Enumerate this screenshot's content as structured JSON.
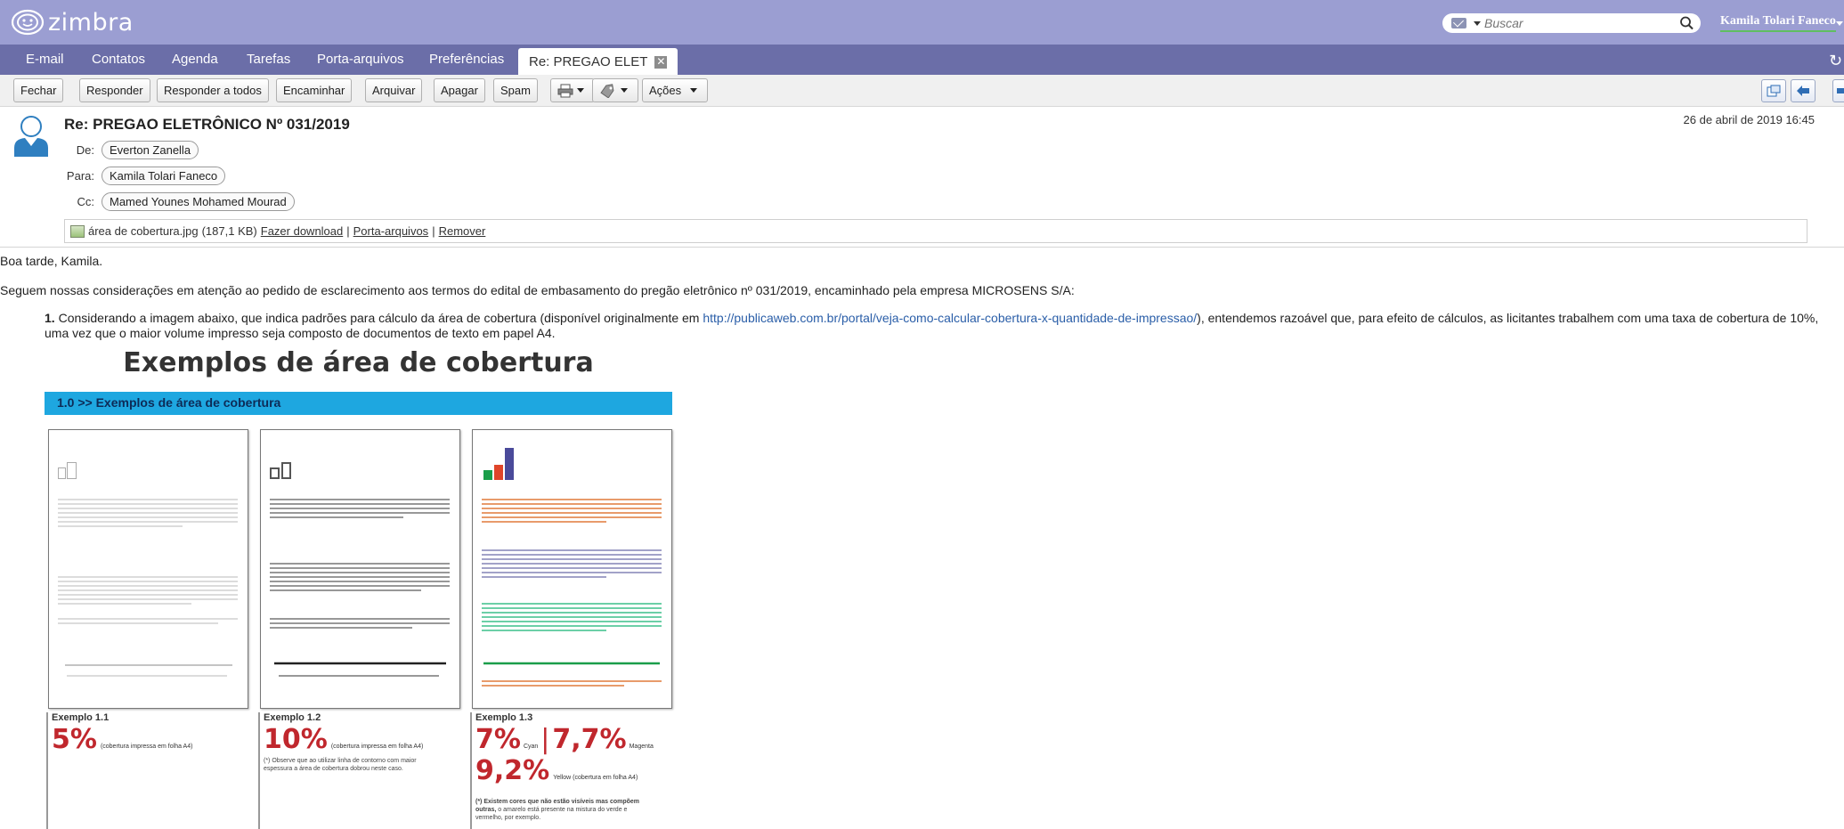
{
  "app": {
    "logo_text": "zimbra",
    "search_placeholder": "Buscar",
    "user_name": "Kamila Tolari Faneco"
  },
  "nav": {
    "tabs": [
      "E-mail",
      "Contatos",
      "Agenda",
      "Tarefas",
      "Porta-arquivos",
      "Preferências"
    ],
    "active_tab": "Re: PREGAO ELET"
  },
  "toolbar": {
    "close": "Fechar",
    "reply": "Responder",
    "reply_all": "Responder a todos",
    "forward": "Encaminhar",
    "archive": "Arquivar",
    "delete": "Apagar",
    "spam": "Spam",
    "actions": "Ações"
  },
  "message": {
    "subject": "Re: PREGAO ELETRÔNICO Nº 031/2019",
    "date": "26 de abril de 2019 16:45",
    "from_label": "De:",
    "from": "Everton Zanella",
    "to_label": "Para:",
    "to": "Kamila Tolari Faneco",
    "cc_label": "Cc:",
    "cc": "Mamed Younes Mohamed Mourad",
    "attachment": {
      "name": "área de cobertura.jpg",
      "size": "(187,1 KB)",
      "download": "Fazer download",
      "briefcase": "Porta-arquivos",
      "remove": "Remover",
      "sep": "|"
    }
  },
  "body": {
    "greeting": "Boa tarde, Kamila.",
    "intro": "Seguem nossas considerações em atenção ao pedido de esclarecimento aos termos do edital de embasamento do pregão eletrônico nº 031/2019, encaminhado pela empresa MICROSENS S/A:",
    "item_number": "1.",
    "item_text_1": " Considerando a imagem abaixo, que indica padrões para cálculo da área de cobertura (disponível originalmente em ",
    "item_link": "http://publicaweb.com.br/portal/veja-como-calcular-cobertura-x-quantidade-de-impressao/",
    "item_text_2": "), entendemos razoável que, para efeito de cálculos, as licitantes trabalhem com uma taxa de cobertura de 10%, uma vez que o maior volume impresso seja composto de documentos de texto em papel A4."
  },
  "image": {
    "title": "Exemplos de área de cobertura",
    "banner": "1.0 >> Exemplos de área de cobertura",
    "ex1": {
      "title": "Exemplo 1.1",
      "value": "5%",
      "caption": "(cobertura impressa em folha A4)"
    },
    "ex2": {
      "title": "Exemplo 1.2",
      "value": "10%",
      "caption": "(cobertura impressa em folha A4)",
      "note": "(*) Observe que ao utilizar linha de contorno com maior espessura a área de cobertura dobrou neste caso."
    },
    "ex3": {
      "title": "Exemplo 1.3",
      "v1": "7%",
      "l1": "Cyan",
      "v2": "7,7%",
      "l2": "Magenta",
      "v3": "9,2%",
      "l3": "Yellow (cobertura em folha A4)",
      "note_bold": "(*) Existem cores que não estão visíveis mas compõem outras,",
      "note": " o amarelo está presente na mistura do verde e vermelho, por exemplo."
    }
  },
  "colors": {
    "topbar": "#9b9ed2",
    "navbar": "#6b6ea8",
    "link": "#2a5ea8",
    "banner": "#1ea7e0",
    "red": "#c0272d"
  }
}
